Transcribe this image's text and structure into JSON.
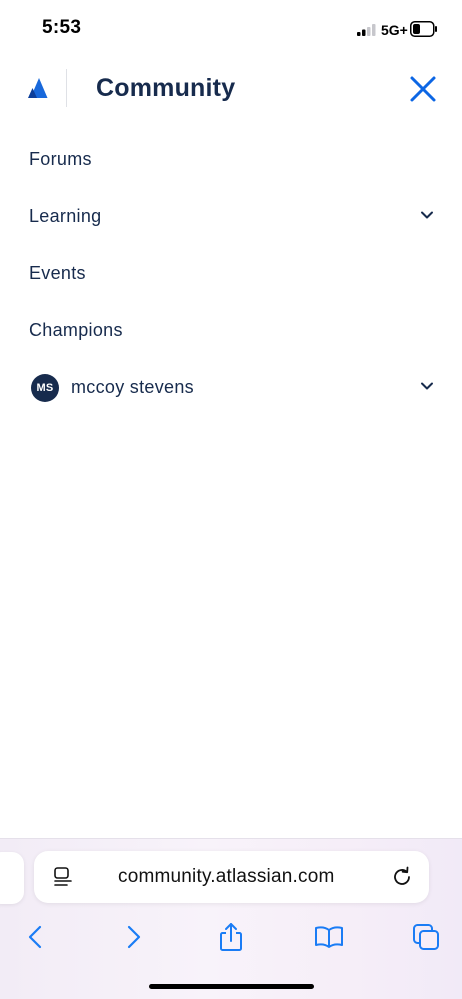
{
  "status_bar": {
    "time": "5:53",
    "network": "5G+",
    "icons": [
      "signal-icon",
      "battery-icon"
    ]
  },
  "header": {
    "title": "Community",
    "logo": "atlassian-logo",
    "close_icon": "close-icon",
    "accent_color": "#0c66e4"
  },
  "nav": {
    "items": [
      {
        "label": "Forums",
        "has_chevron": false
      },
      {
        "label": "Learning",
        "has_chevron": true
      },
      {
        "label": "Events",
        "has_chevron": false
      },
      {
        "label": "Champions",
        "has_chevron": false
      }
    ],
    "user": {
      "initials": "MS",
      "name": "mccoy stevens",
      "has_chevron": true
    }
  },
  "browser": {
    "url": "community.atlassian.com",
    "icons": [
      "reader-mode-icon",
      "reload-icon",
      "back-icon",
      "forward-icon",
      "share-icon",
      "bookmarks-icon",
      "tabs-icon"
    ],
    "icon_color": "#1a7cf5"
  }
}
